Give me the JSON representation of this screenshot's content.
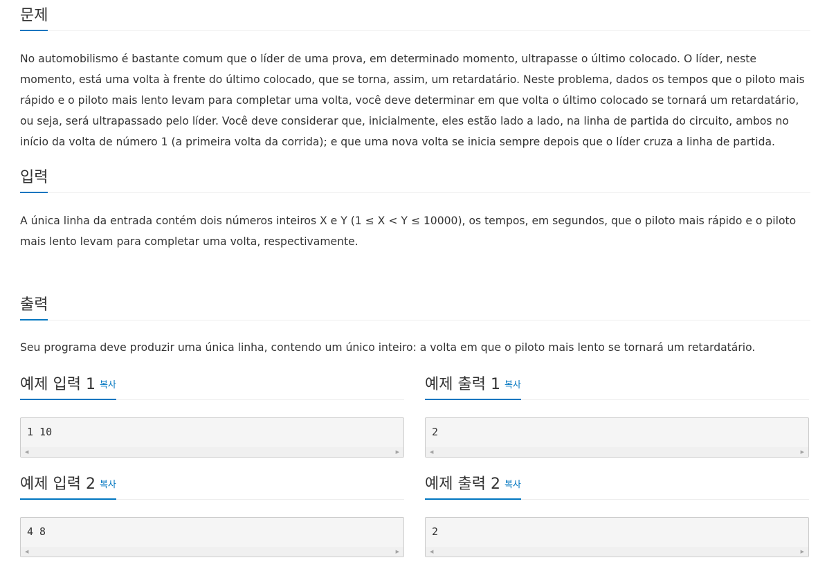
{
  "problem": {
    "title": "문제",
    "text": "No automobilismo é bastante comum que o líder de uma prova, em determinado momento, ultrapasse o último colocado. O líder, neste momento, está uma volta à frente do último colocado, que se torna, assim, um retardatário. Neste problema, dados os tempos que o piloto mais rápido e o piloto mais lento levam para completar uma volta, você deve determinar em que volta o último colocado se tornará um retardatário, ou seja, será ultrapassado pelo líder. Você deve considerar que, inicialmente, eles estão lado a lado, na linha de partida do circuito, ambos no início da volta de número 1 (a primeira volta da corrida); e que uma nova volta se inicia sempre depois que o líder cruza a linha de partida."
  },
  "input": {
    "title": "입력",
    "text": "A única linha da entrada contém dois números inteiros X e Y (1 ≤ X < Y ≤ 10000), os tempos, em segundos, que o piloto mais rápido e o piloto mais lento levam para completar uma volta, respectivamente."
  },
  "output": {
    "title": "출력",
    "text": "Seu programa deve produzir uma única linha, contendo um único inteiro: a volta em que o piloto mais lento se tornará um retardatário."
  },
  "samples": {
    "copy_label": "복사",
    "scroll_left": "◀",
    "scroll_right": "▶",
    "input1": {
      "title": "예제 입력 1",
      "content": "1 10"
    },
    "output1": {
      "title": "예제 출력 1",
      "content": "2"
    },
    "input2": {
      "title": "예제 입력 2",
      "content": "4 8"
    },
    "output2": {
      "title": "예제 출력 2",
      "content": "2"
    }
  },
  "colors": {
    "accent": "#0076c0",
    "text": "#333333",
    "code_bg": "#f5f5f5",
    "code_border": "#cccccc"
  }
}
